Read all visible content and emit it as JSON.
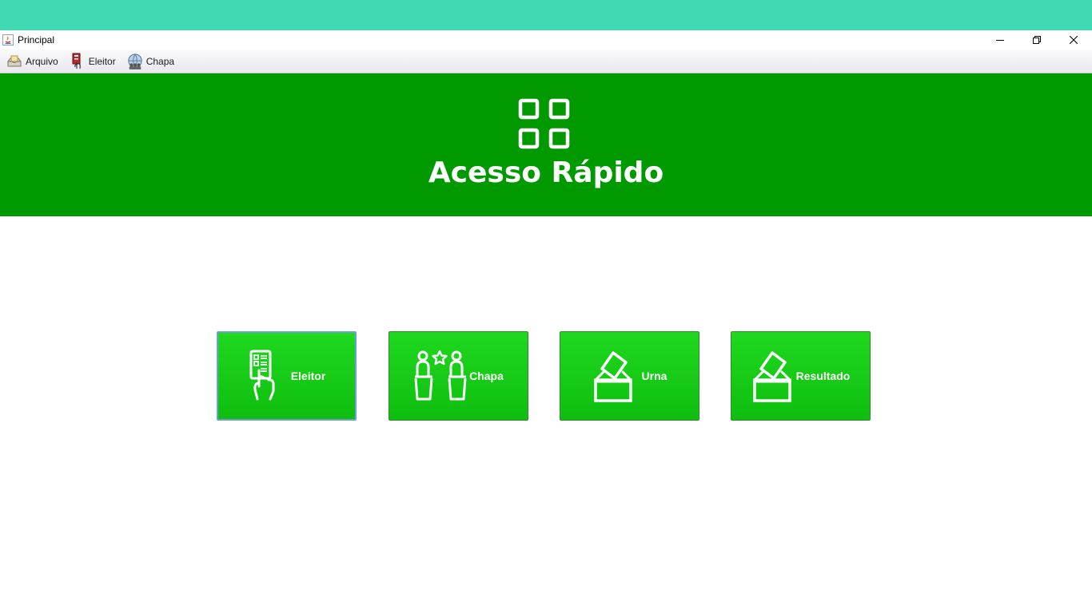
{
  "window": {
    "title": "Principal",
    "controls": [
      "minimize-icon",
      "restore-icon",
      "close-icon"
    ]
  },
  "menu": {
    "items": [
      {
        "label": "Arquivo",
        "icon": "envelope-tray-icon"
      },
      {
        "label": "Eleitor",
        "icon": "voter-id-icon"
      },
      {
        "label": "Chapa",
        "icon": "group-globe-icon"
      }
    ]
  },
  "banner": {
    "title": "Acesso Rápido",
    "icon": "grid-squares-icon",
    "color": "#009900"
  },
  "tiles": [
    {
      "label": "Eleitor",
      "icon": "voter-card-hand-icon"
    },
    {
      "label": "Chapa",
      "icon": "candidates-podium-icon"
    },
    {
      "label": "Urna",
      "icon": "ballot-box-icon"
    },
    {
      "label": "Resultado",
      "icon": "ballot-box-icon"
    }
  ],
  "colors": {
    "desktop": "#40d9b4",
    "tile_green": "#1fd81f",
    "banner_green": "#009900"
  }
}
